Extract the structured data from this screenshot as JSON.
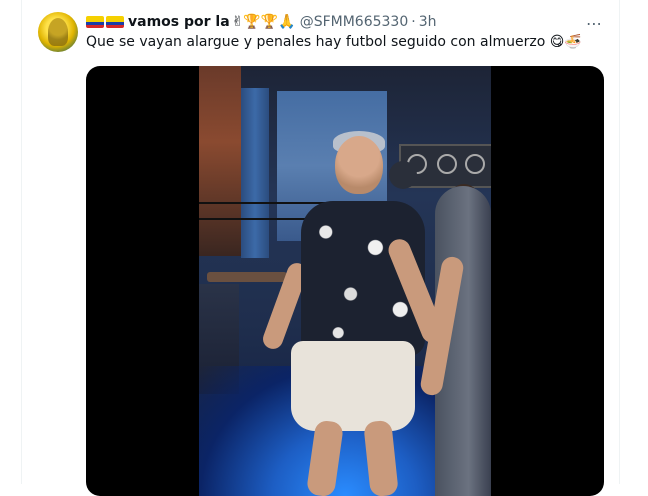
{
  "tweet": {
    "display_name": "vamos por la",
    "name_emojis": "✌🏆🏆🙏",
    "handle": "@SFMM665330",
    "separator": "·",
    "time": "3h",
    "more_icon": "⋯",
    "text": "Que se vayan alargue y penales hay futbol seguido con almuerzo 😋🍜"
  },
  "media": {
    "type": "video",
    "description_icon": "video-frame"
  },
  "colors": {
    "secondary_text": "#536471",
    "primary_text": "#0f1419",
    "border": "#eff3f4"
  }
}
